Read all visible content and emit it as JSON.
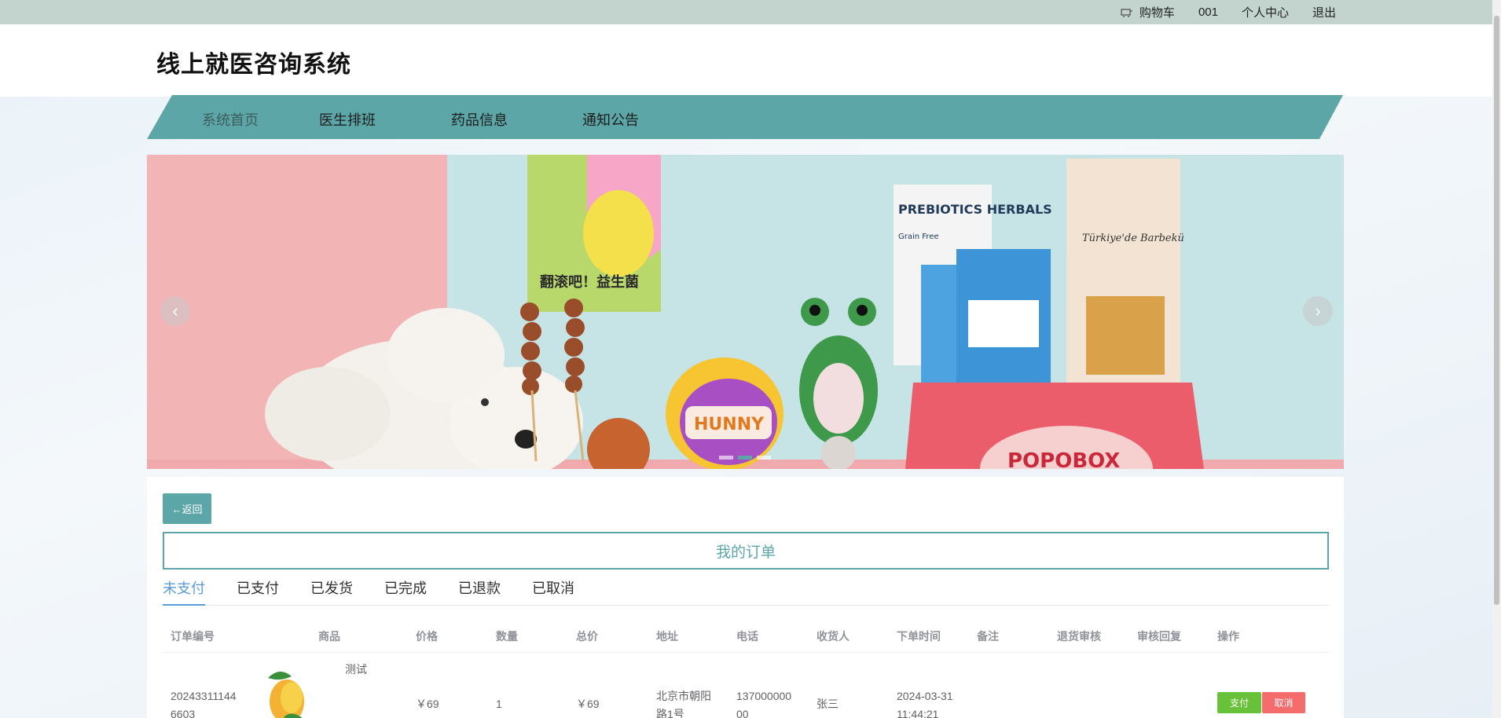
{
  "topbar": {
    "cart_label": "购物车",
    "user_label": "001",
    "profile_label": "个人中心",
    "logout_label": "退出"
  },
  "header": {
    "site_title": "线上就医咨询系统"
  },
  "nav": {
    "items": [
      {
        "label": "系统首页",
        "active": true
      },
      {
        "label": "医生排班",
        "active": false
      },
      {
        "label": "药品信息",
        "active": false
      },
      {
        "label": "通知公告",
        "active": false
      }
    ]
  },
  "banner": {
    "left_arrow": "‹",
    "right_arrow": "›",
    "poster_text": "翻滚吧！益生菌",
    "bag1_text": "PREBIOTICS HERBALS",
    "bag1_sub": "Grain Free",
    "bag2_text": "Türkiye'de Barbekü",
    "toy_text": "HUNNY",
    "box_text": "POPOBOX"
  },
  "content": {
    "back_label": "←返回",
    "title": "我的订单",
    "tabs": [
      {
        "label": "未支付",
        "active": true
      },
      {
        "label": "已支付",
        "active": false
      },
      {
        "label": "已发货",
        "active": false
      },
      {
        "label": "已完成",
        "active": false
      },
      {
        "label": "已退款",
        "active": false
      },
      {
        "label": "已取消",
        "active": false
      }
    ],
    "columns": [
      "订单编号",
      "商品",
      "价格",
      "数量",
      "总价",
      "地址",
      "电话",
      "收货人",
      "下单时间",
      "备注",
      "退货审核",
      "审核回复",
      "操作"
    ],
    "rows": [
      {
        "order_no_1": "20243311144",
        "order_no_2": "6603",
        "product": "测试",
        "price": "￥69",
        "quantity": "1",
        "total": "￥69",
        "address_1": "北京市朝阳",
        "address_2": "路1号",
        "phone_1": "137000000",
        "phone_2": "00",
        "receiver": "张三",
        "time_1": "2024-03-31",
        "time_2": "11:44:21",
        "pay_label": "支付",
        "cancel_label": "取消"
      }
    ]
  },
  "colors": {
    "accent": "#5ca6a8",
    "tab_active": "#5a9cd6",
    "pay": "#67c23a",
    "cancel": "#f56c6c"
  }
}
